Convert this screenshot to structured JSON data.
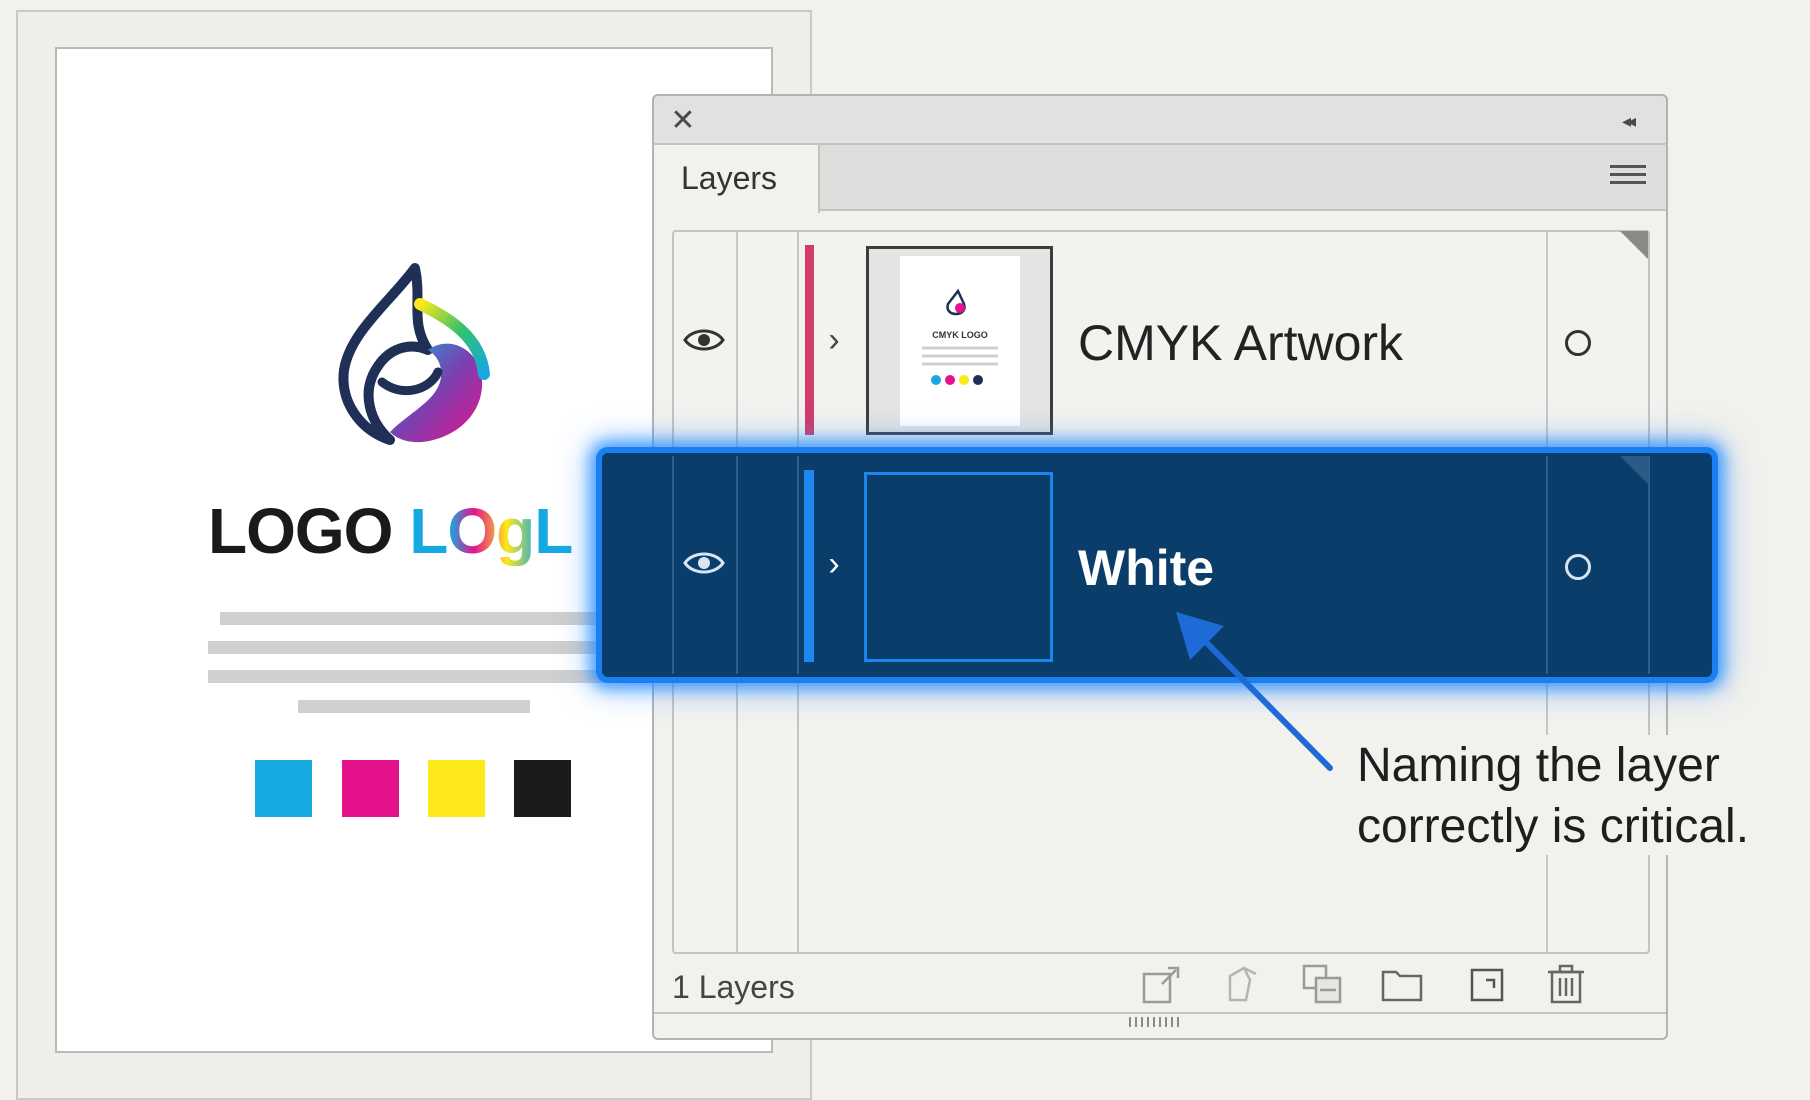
{
  "colors": {
    "accent": "#1a7ff0",
    "selected_row": "#0a3d6a",
    "cyan": "#16a9e1",
    "magenta": "#e4138c",
    "yellow": "#fde81a",
    "black": "#1b1b1b",
    "row1_layer_color": "#d23b6c",
    "row2_layer_color": "#1f86f2"
  },
  "document": {
    "logo_words": [
      "LOGO",
      "LOgL"
    ],
    "thumbnail_text": "CMYK LOGO",
    "swatches": [
      "cyan",
      "magenta",
      "yellow",
      "black"
    ]
  },
  "panel": {
    "close_icon": "close-icon",
    "collapse_icon": "double-chevron-left-icon",
    "tab_label": "Layers",
    "menu_icon": "hamburger-menu-icon",
    "layers": [
      {
        "name": "CMYK Artwork",
        "visible": true,
        "selected": false,
        "thumbnail": "artwork-thumbnail"
      },
      {
        "name": "White",
        "visible": true,
        "selected": true,
        "thumbnail": "empty-thumbnail"
      }
    ],
    "footer": {
      "count_label": "1 Layers",
      "icons": [
        "export-icon",
        "clipping-mask-icon",
        "new-sublayer-icon",
        "folder-icon",
        "new-layer-icon",
        "trash-icon"
      ]
    }
  },
  "annotation": {
    "line1": "Naming the layer",
    "line2": "correctly is critical."
  }
}
